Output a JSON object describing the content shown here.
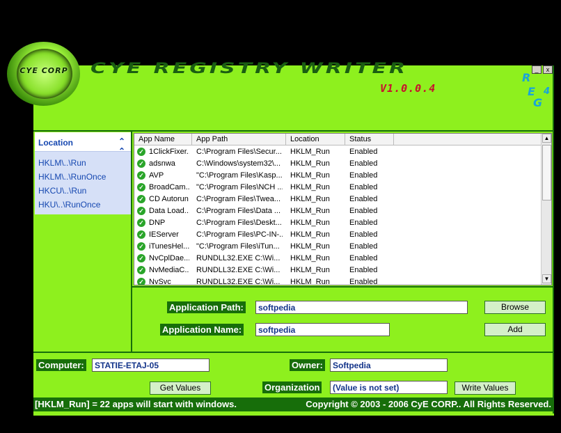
{
  "app": {
    "logo_text": "CYE CORP",
    "title": "CYE REGISTRY WRITER",
    "version": "V1.0.0.4",
    "reg_letters": [
      "R",
      "E",
      "G"
    ],
    "reg_number": "4",
    "window_buttons": [
      "_",
      "x"
    ]
  },
  "sidebar": {
    "header": "Location",
    "items": [
      "HKLM\\..\\Run",
      "HKLM\\..\\RunOnce",
      "HKCU\\..\\Run",
      "HKU\\..\\RunOnce"
    ]
  },
  "table": {
    "columns": [
      "App Name",
      "App Path",
      "Location",
      "Status"
    ],
    "rows": [
      [
        "1ClickFixer...",
        "C:\\Program Files\\Secur...",
        "HKLM_Run",
        "Enabled"
      ],
      [
        "adsnwa",
        "C:\\Windows\\system32\\...",
        "HKLM_Run",
        "Enabled"
      ],
      [
        "AVP",
        "\"C:\\Program Files\\Kasp...",
        "HKLM_Run",
        "Enabled"
      ],
      [
        "BroadCam...",
        "\"C:\\Program Files\\NCH ...",
        "HKLM_Run",
        "Enabled"
      ],
      [
        "CD Autorun",
        "C:\\Program Files\\Twea...",
        "HKLM_Run",
        "Enabled"
      ],
      [
        "Data Load...",
        "C:\\Program Files\\Data ...",
        "HKLM_Run",
        "Enabled"
      ],
      [
        "DNP",
        "C:\\Program Files\\Deskt...",
        "HKLM_Run",
        "Enabled"
      ],
      [
        "IEServer",
        "C:\\Program Files\\PC-IN-...",
        "HKLM_Run",
        "Enabled"
      ],
      [
        "iTunesHel...",
        "\"C:\\Program Files\\iTun...",
        "HKLM_Run",
        "Enabled"
      ],
      [
        "NvCplDae...",
        "RUNDLL32.EXE C:\\Wi...",
        "HKLM_Run",
        "Enabled"
      ],
      [
        "NvMediaC...",
        "RUNDLL32.EXE C:\\Wi...",
        "HKLM_Run",
        "Enabled"
      ],
      [
        "NvSvc",
        "RUNDLL32.EXE C:\\Wi...",
        "HKLM_Run",
        "Enabled"
      ]
    ]
  },
  "form": {
    "app_path_label": "Application Path:",
    "app_path_value": "softpedia",
    "app_name_label": "Application Name:",
    "app_name_value": "softpedia",
    "browse_label": "Browse",
    "add_label": "Add"
  },
  "system": {
    "computer_label": "Computer:",
    "computer_value": "STATIE-ETAJ-05",
    "owner_label": "Owner:",
    "owner_value": "Softpedia",
    "organization_label": "Organization",
    "organization_value": "(Value is not set)",
    "get_values_label": "Get Values",
    "write_values_label": "Write Values"
  },
  "status": {
    "left": "[HKLM_Run] = 22 apps will start with windows.",
    "right": "Copyright © 2003 - 2006 CyE CORP.. All Rights Reserved."
  },
  "colors": {
    "background": "#8ef01e",
    "accent_dark": "#176e0a",
    "version": "#c8102e",
    "link": "#1547b0"
  }
}
